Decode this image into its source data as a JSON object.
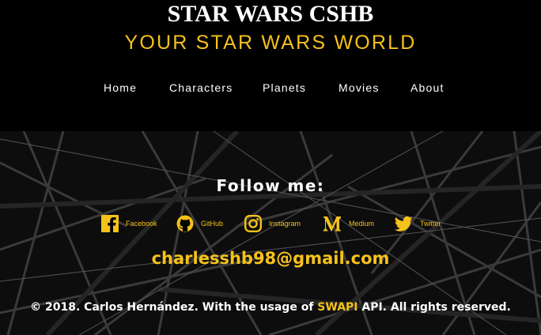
{
  "header": {
    "title": "STAR WARS CSHB",
    "subtitle": "YOUR STAR WARS WORLD"
  },
  "nav": {
    "items": [
      {
        "label": "Home"
      },
      {
        "label": "Characters"
      },
      {
        "label": "Planets"
      },
      {
        "label": "Movies"
      },
      {
        "label": "About"
      }
    ]
  },
  "footer": {
    "follow_label": "Follow me:",
    "social": [
      {
        "label": "Facebook",
        "icon": "facebook-icon"
      },
      {
        "label": "GitHub",
        "icon": "github-icon"
      },
      {
        "label": "Instagram",
        "icon": "instagram-icon"
      },
      {
        "label": "Medium",
        "icon": "medium-icon"
      },
      {
        "label": "Twitter",
        "icon": "twitter-icon"
      }
    ],
    "email": "charlesshb98@gmail.com",
    "copyright_prefix": "© 2018. Carlos Hernández. With the usage of ",
    "copyright_link": "SWAPI",
    "copyright_suffix": " API. All rights reserved."
  },
  "colors": {
    "accent": "#f6c21a",
    "background": "#000000",
    "text": "#ffffff"
  }
}
